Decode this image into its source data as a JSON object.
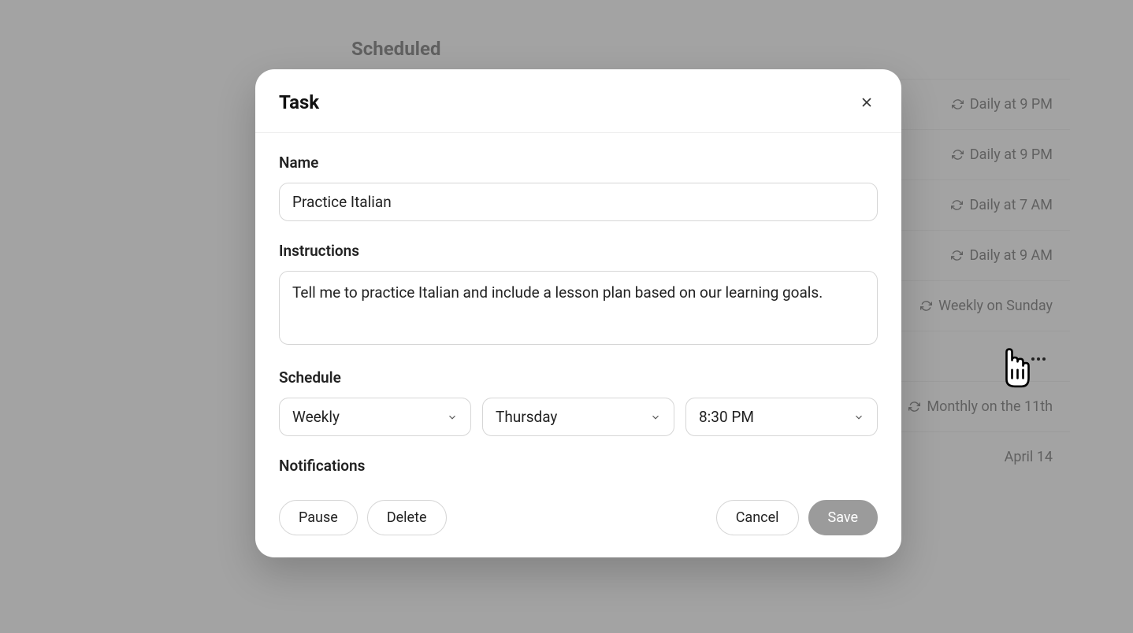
{
  "page": {
    "title": "Scheduled"
  },
  "bg_rows": [
    {
      "schedule": "Daily at 9 PM",
      "recurring": true
    },
    {
      "schedule": "Daily at 9 PM",
      "recurring": true
    },
    {
      "schedule": "Daily at 7 AM",
      "recurring": true
    },
    {
      "schedule": "Daily at 9 AM",
      "recurring": true
    },
    {
      "schedule": "Weekly on Sunday",
      "recurring": true
    },
    {
      "schedule": "",
      "recurring": false
    },
    {
      "schedule": "Monthly on the 11th",
      "recurring": true
    },
    {
      "schedule": "April 14",
      "recurring": false
    }
  ],
  "modal": {
    "title": "Task",
    "name_label": "Name",
    "name_value": "Practice Italian",
    "instructions_label": "Instructions",
    "instructions_value": "Tell me to practice Italian and include a lesson plan based on our learning goals.",
    "schedule_label": "Schedule",
    "frequency_value": "Weekly",
    "day_value": "Thursday",
    "time_value": "8:30 PM",
    "notifications_label": "Notifications",
    "buttons": {
      "pause": "Pause",
      "delete": "Delete",
      "cancel": "Cancel",
      "save": "Save"
    }
  }
}
